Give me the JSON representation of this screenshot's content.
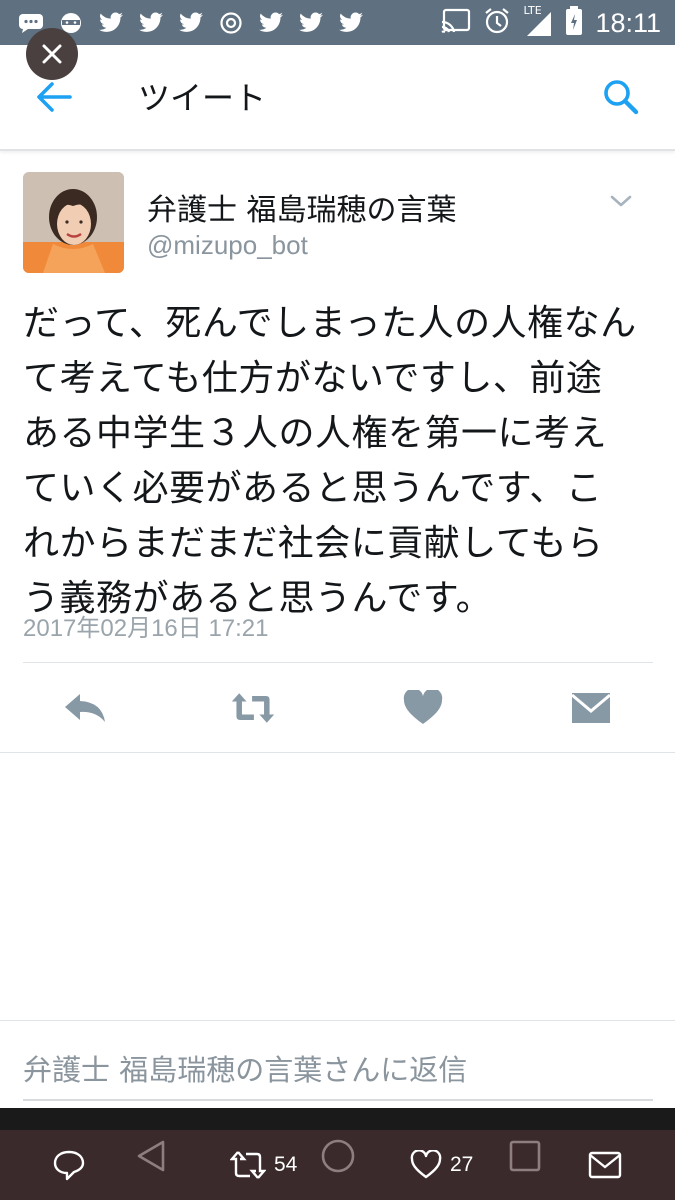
{
  "status_bar": {
    "time": "18:11",
    "network": "LTE",
    "left_icons": [
      "chat-bubble-icon",
      "ninja-icon",
      "twitter-icon",
      "twitter-icon",
      "twitter-icon",
      "circle-at-icon",
      "twitter-icon",
      "twitter-icon",
      "twitter-icon"
    ],
    "right_icons": [
      "cast-icon",
      "alarm-icon",
      "signal-icon",
      "battery-icon"
    ]
  },
  "toolbar": {
    "title": "ツイート"
  },
  "tweet": {
    "display_name": "弁護士 福島瑞穂の言葉",
    "handle": "@mizupo_bot",
    "text": "だって、死んでしまった人の人権なん\nて考えても仕方がないですし、前途\nある中学生３人の人権を第一に考え\nていく必要があると思うんです、こ\nれからまだまだ社会に貢献してもら\nう義務があると思うんです。",
    "timestamp": "2017年02月16日 17:21"
  },
  "reply": {
    "placeholder": "弁護士 福島瑞穂の言葉さんに返信"
  },
  "bottom_bar": {
    "retweet_count": "54",
    "like_count": "27"
  },
  "colors": {
    "accent": "#1da1f2",
    "status_bar": "#5f7081",
    "action_icon": "#8899a6",
    "nav_bar": "#3b2a2c"
  }
}
